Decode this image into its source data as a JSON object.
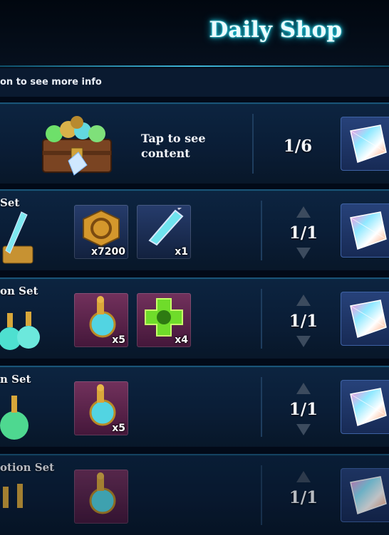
{
  "header": {
    "title": "Daily Shop"
  },
  "hint": "on to see more info",
  "rows": [
    {
      "name": "",
      "description": "Tap to see content",
      "count": "1/6",
      "items": []
    },
    {
      "name": "Set",
      "count": "1/1",
      "items": [
        {
          "icon": "gold-emblem-icon",
          "qty": "x7200"
        },
        {
          "icon": "crystal-syringe-icon",
          "qty": "x1"
        }
      ]
    },
    {
      "name": "on Set",
      "count": "1/1",
      "items": [
        {
          "icon": "potion-flask-icon",
          "qty": "x5"
        },
        {
          "icon": "green-cross-icon",
          "qty": "x4"
        }
      ]
    },
    {
      "name": "n Set",
      "count": "1/1",
      "items": [
        {
          "icon": "potion-flask-icon",
          "qty": "x5"
        }
      ]
    },
    {
      "name": "otion Set",
      "count": "1/1",
      "items": [
        {
          "icon": "potion-flask-icon",
          "qty": ""
        }
      ]
    }
  ],
  "price_icon": "rainbow-crystal-icon",
  "colors": {
    "title_glow": "#22d6e8",
    "row_bg": "#0a1d36",
    "row_border": "#1a5478"
  }
}
